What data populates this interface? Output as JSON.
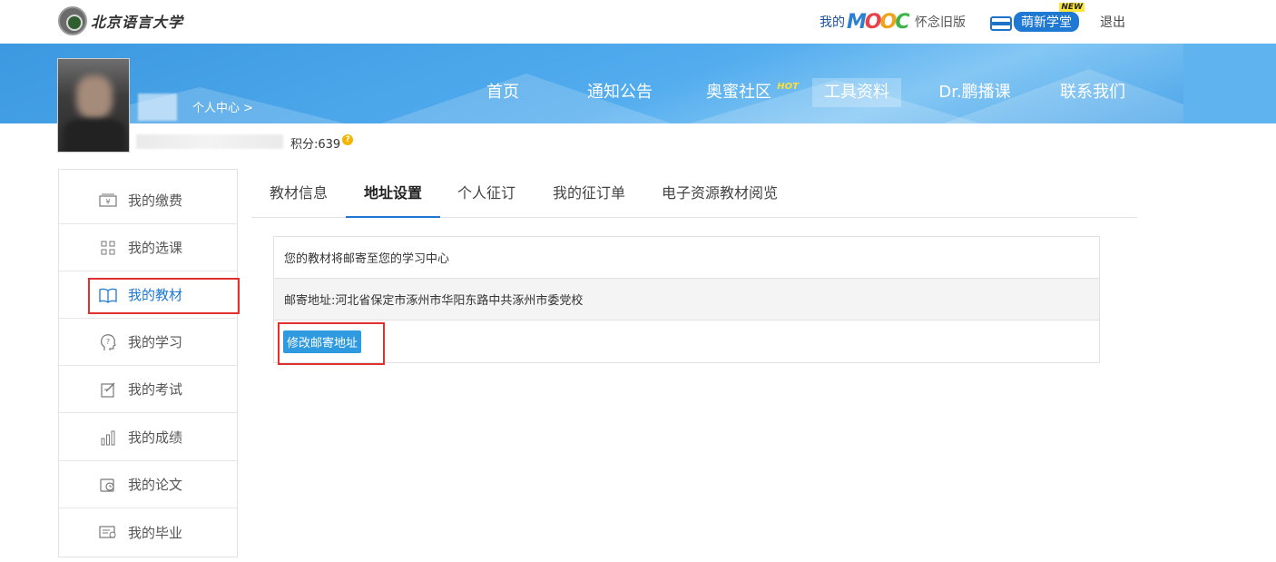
{
  "header": {
    "logo_text": "北京语言大学",
    "my_mooc_label": "我的",
    "mooc_letters": [
      "M",
      "O",
      "O",
      "C"
    ],
    "old_version": "怀念旧版",
    "mengxin_label": "萌新学堂",
    "new_badge": "NEW",
    "logout": "退出"
  },
  "nav": {
    "items": [
      {
        "label": "首页"
      },
      {
        "label": "通知公告"
      },
      {
        "label": "奥蜜社区",
        "badge": "HOT"
      },
      {
        "label": "工具资料",
        "active": true
      },
      {
        "label": "Dr.鹏播课"
      },
      {
        "label": "联系我们"
      }
    ]
  },
  "profile": {
    "personal_center": "个人中心 >",
    "points_label": "积分:639",
    "points_help_icon": "?"
  },
  "sidebar": {
    "items": [
      {
        "label": "我的缴费",
        "icon": "payment-icon"
      },
      {
        "label": "我的选课",
        "icon": "grid-icon"
      },
      {
        "label": "我的教材",
        "icon": "book-open-icon",
        "active": true
      },
      {
        "label": "我的学习",
        "icon": "head-question-icon"
      },
      {
        "label": "我的考试",
        "icon": "exam-edit-icon"
      },
      {
        "label": "我的成绩",
        "icon": "bar-chart-icon"
      },
      {
        "label": "我的论文",
        "icon": "thesis-icon"
      },
      {
        "label": "我的毕业",
        "icon": "certificate-icon"
      }
    ]
  },
  "tabs": {
    "items": [
      {
        "label": "教材信息"
      },
      {
        "label": "地址设置",
        "active": true
      },
      {
        "label": "个人征订"
      },
      {
        "label": "我的征订单"
      },
      {
        "label": "电子资源教材阅览"
      }
    ]
  },
  "address": {
    "notice": "您的教材将邮寄至您的学习中心",
    "mailing_address": "邮寄地址:河北省保定市涿州市华阳东路中共涿州市委党校",
    "edit_button": "修改邮寄地址"
  },
  "colors": {
    "accent": "#1f78d1",
    "banner": "#4ba8ec",
    "highlight_box": "#e03131"
  }
}
